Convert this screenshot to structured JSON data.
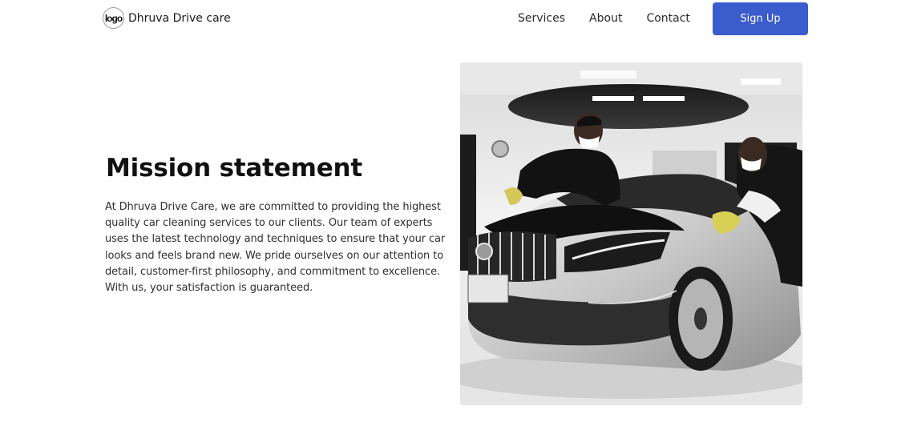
{
  "nav": {
    "logo_text": "logo",
    "brand": "Dhruva Drive care",
    "links": [
      "Services",
      "About",
      "Contact"
    ],
    "signup_label": "Sign Up",
    "signup_color": "#3a5ccc"
  },
  "hero": {
    "heading": "Mission statement",
    "body": "At Dhruva Drive Care, we are committed to providing the highest quality car cleaning services to our clients. Our team of experts uses the latest technology and techniques to ensure that your car looks and feels brand new. We pride ourselves on our attention to detail, customer-first philosophy, and commitment to excellence. With us, your satisfaction is guaranteed."
  }
}
